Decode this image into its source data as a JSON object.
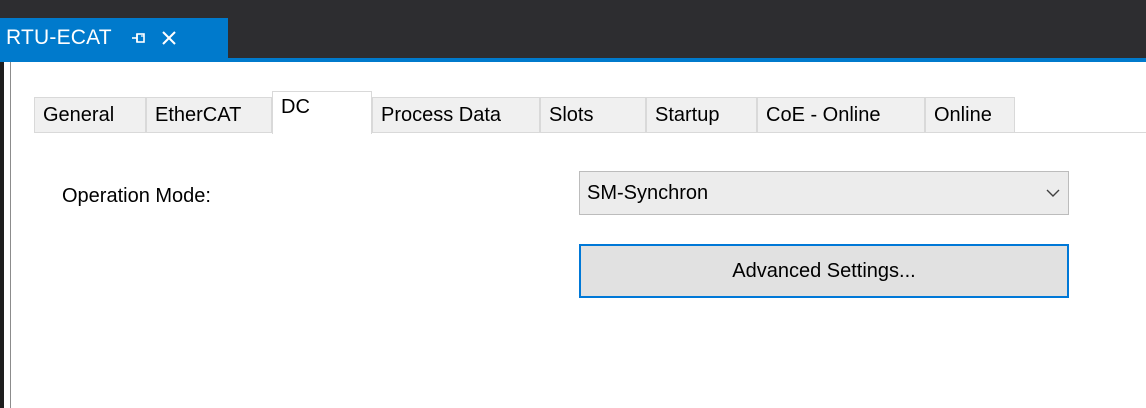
{
  "document_tab": {
    "title": "RTU-ECAT",
    "pin_icon": "pin-icon",
    "close_icon": "close-icon"
  },
  "tabs": [
    {
      "label": "General",
      "active": false
    },
    {
      "label": "EtherCAT",
      "active": false
    },
    {
      "label": "DC",
      "active": true
    },
    {
      "label": "Process Data",
      "active": false
    },
    {
      "label": "Slots",
      "active": false
    },
    {
      "label": "Startup",
      "active": false
    },
    {
      "label": "CoE - Online",
      "active": false
    },
    {
      "label": "Online",
      "active": false
    }
  ],
  "dc_panel": {
    "operation_mode_label": "Operation Mode:",
    "operation_mode_value": "SM-Synchron",
    "dropdown_icon": "chevron-down-icon",
    "advanced_settings_label": "Advanced Settings..."
  },
  "colors": {
    "accent": "#007acc",
    "title_bar": "#2d2d30",
    "focus_border": "#0078d7"
  }
}
